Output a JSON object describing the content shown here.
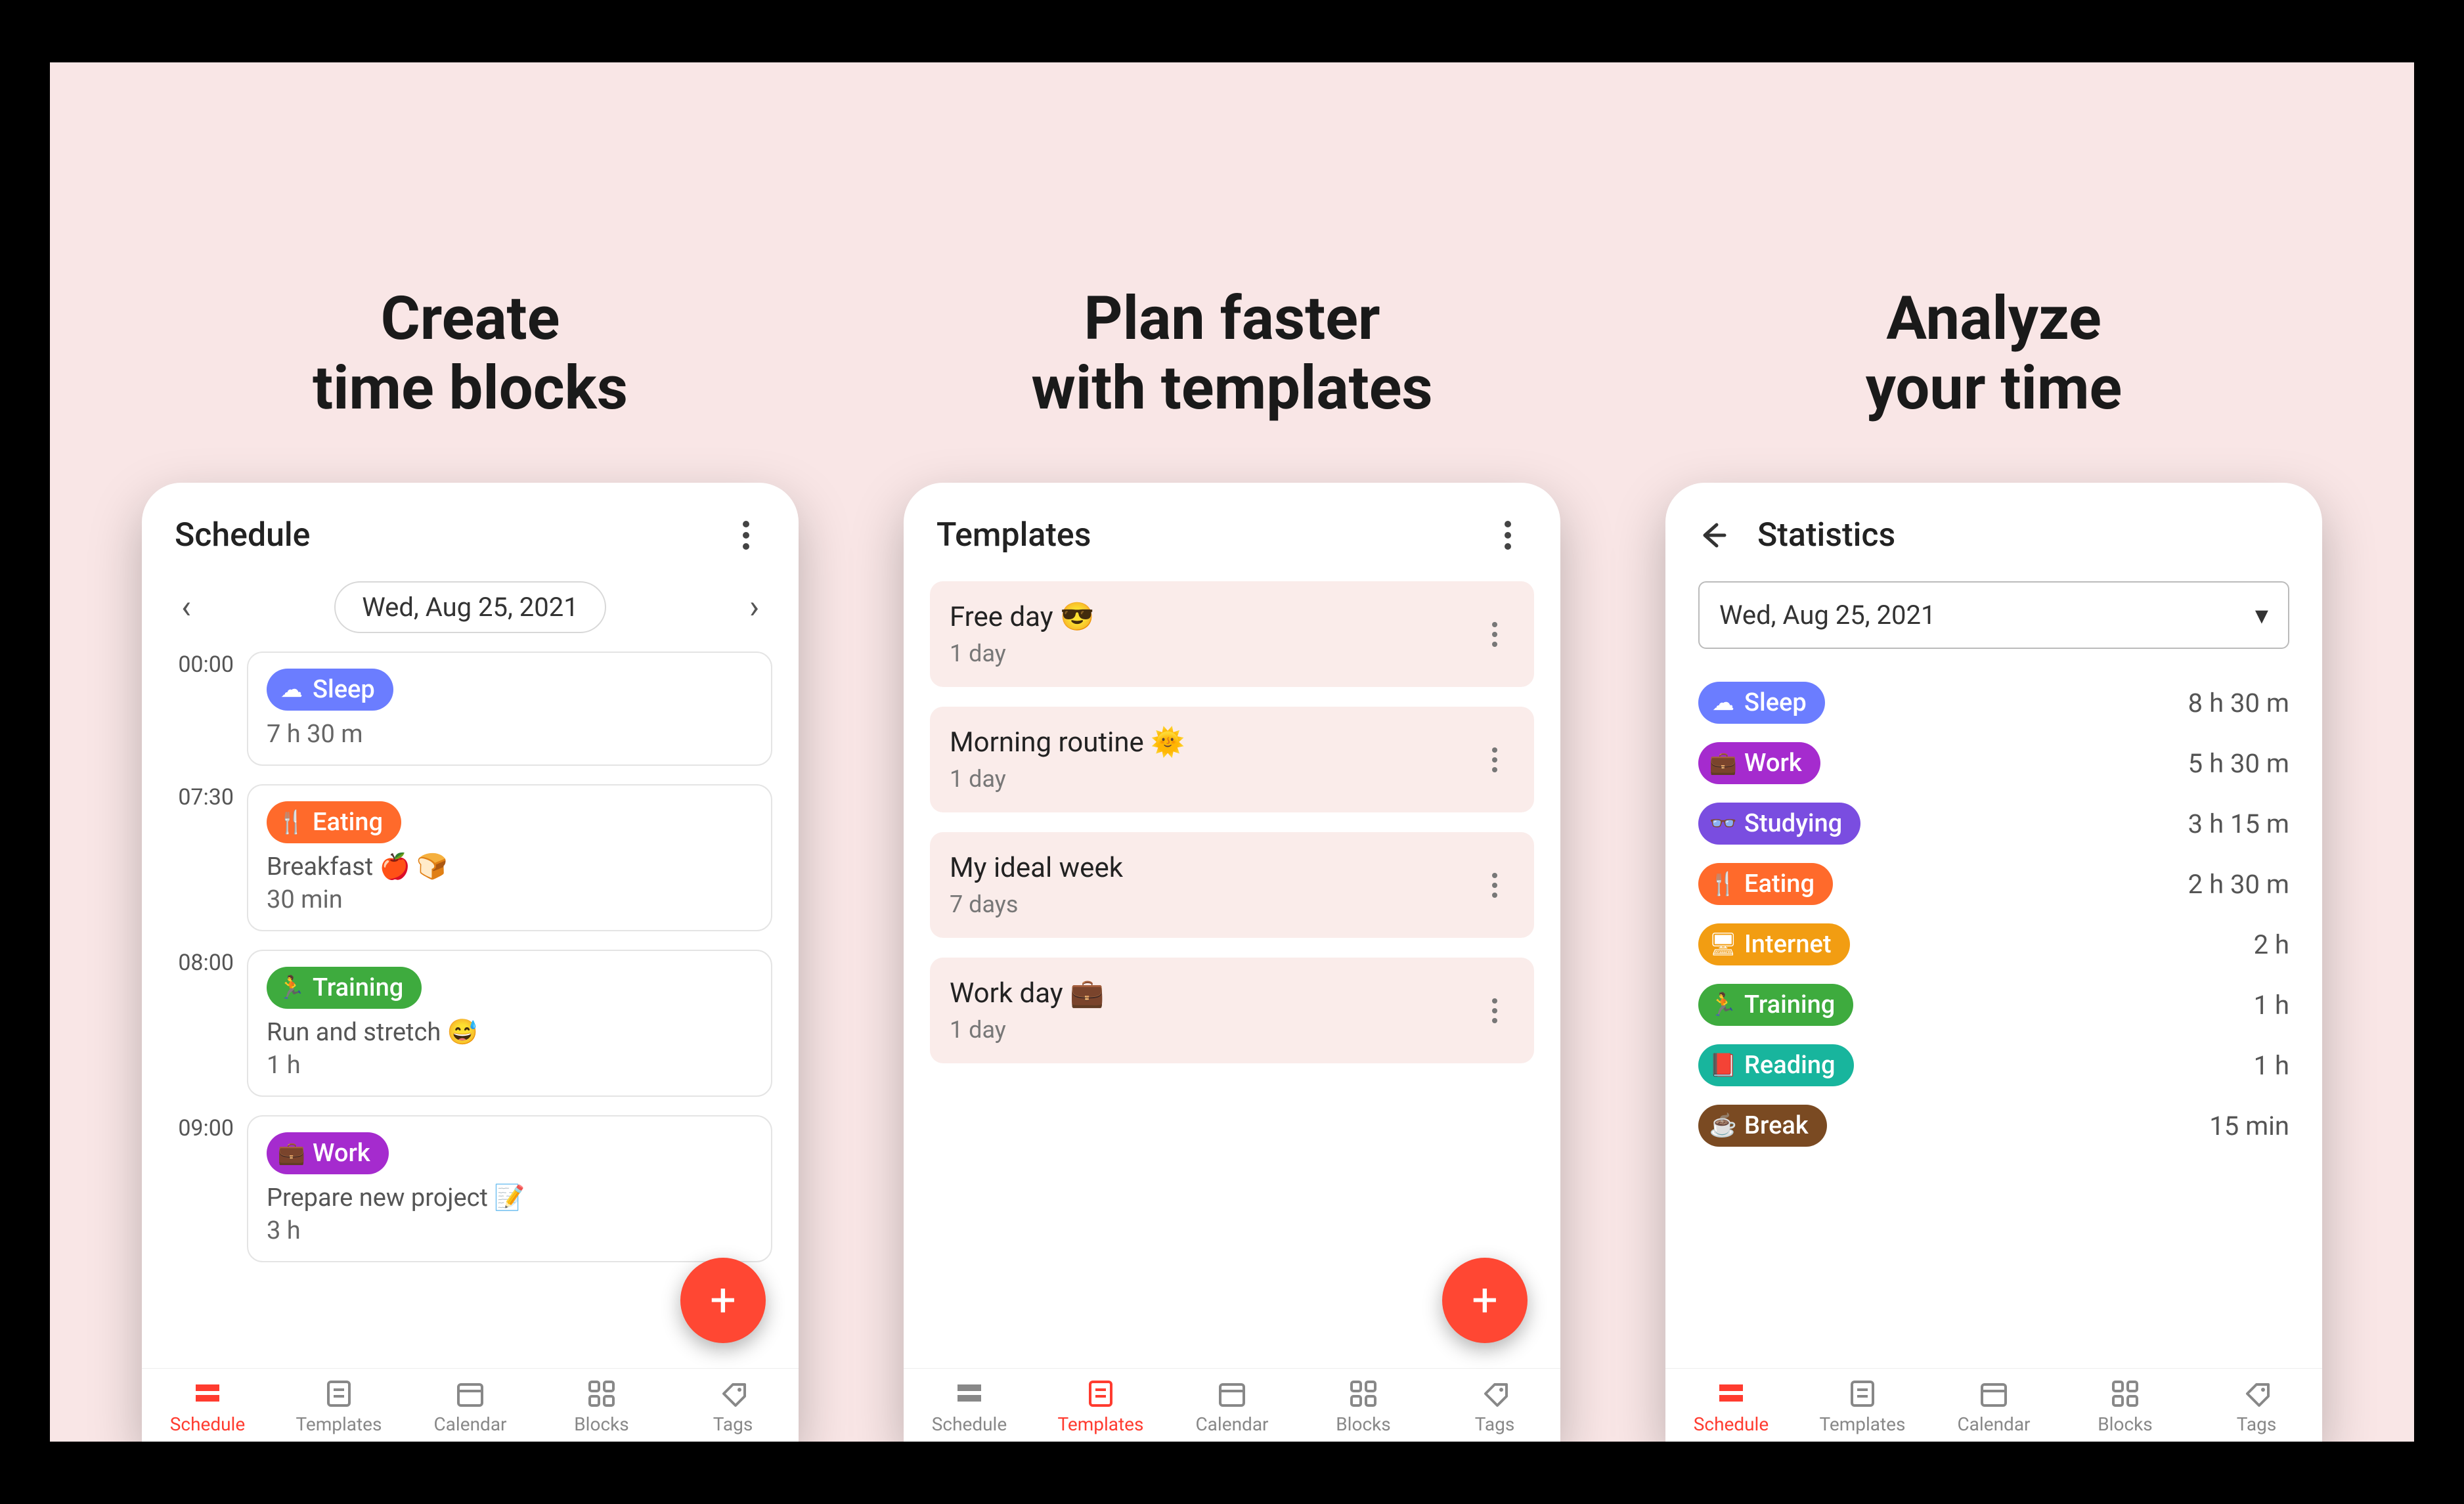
{
  "headlines": {
    "create": "Create\ntime blocks",
    "plan": "Plan faster\nwith templates",
    "analyze": "Analyze\nyour time"
  },
  "colors": {
    "sleep": "#6b7dff",
    "eating": "#ff6a2b",
    "training": "#3eab3e",
    "work": "#a52bce",
    "studying": "#7a4de0",
    "internet": "#f29d12",
    "reading": "#18b59d",
    "break": "#7a4a22",
    "accent": "#ff3b2f"
  },
  "nav": {
    "items": [
      {
        "key": "schedule",
        "label": "Schedule"
      },
      {
        "key": "templates",
        "label": "Templates"
      },
      {
        "key": "calendar",
        "label": "Calendar"
      },
      {
        "key": "blocks",
        "label": "Blocks"
      },
      {
        "key": "tags",
        "label": "Tags"
      }
    ]
  },
  "schedule": {
    "title": "Schedule",
    "date": "Wed, Aug 25, 2021",
    "blocks": [
      {
        "time": "00:00",
        "tag": "Sleep",
        "color": "sleep",
        "icon": "cloud",
        "desc": "",
        "dur": "7 h 30 m"
      },
      {
        "time": "07:30",
        "tag": "Eating",
        "color": "eating",
        "icon": "fork",
        "desc": "Breakfast 🍎 🍞",
        "dur": "30 min"
      },
      {
        "time": "08:00",
        "tag": "Training",
        "color": "training",
        "icon": "run",
        "desc": "Run and stretch 😅",
        "dur": "1 h"
      },
      {
        "time": "09:00",
        "tag": "Work",
        "color": "work",
        "icon": "brief",
        "desc": "Prepare new project 📝",
        "dur": "3 h"
      }
    ]
  },
  "templates": {
    "title": "Templates",
    "items": [
      {
        "title": "Free day 😎",
        "sub": "1 day"
      },
      {
        "title": "Morning routine 🌞",
        "sub": "1 day"
      },
      {
        "title": "My ideal week",
        "sub": "7 days"
      },
      {
        "title": "Work day 💼",
        "sub": "1 day"
      }
    ]
  },
  "stats": {
    "title": "Statistics",
    "date": "Wed, Aug 25, 2021",
    "rows": [
      {
        "tag": "Sleep",
        "color": "sleep",
        "icon": "cloud",
        "value": "8 h 30 m"
      },
      {
        "tag": "Work",
        "color": "work",
        "icon": "brief",
        "value": "5 h 30 m"
      },
      {
        "tag": "Studying",
        "color": "studying",
        "icon": "glass",
        "value": "3 h 15 m"
      },
      {
        "tag": "Eating",
        "color": "eating",
        "icon": "fork",
        "value": "2 h 30 m"
      },
      {
        "tag": "Internet",
        "color": "internet",
        "icon": "screen",
        "value": "2 h"
      },
      {
        "tag": "Training",
        "color": "training",
        "icon": "run",
        "value": "1 h"
      },
      {
        "tag": "Reading",
        "color": "reading",
        "icon": "book",
        "value": "1 h"
      },
      {
        "tag": "Break",
        "color": "break",
        "icon": "cup",
        "value": "15 min"
      }
    ]
  }
}
